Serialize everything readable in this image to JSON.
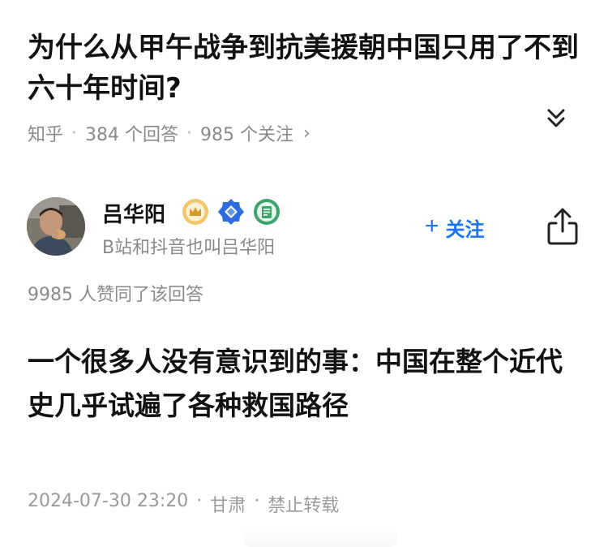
{
  "question": {
    "title": "为什么从甲午战争到抗美援朝中国只用了不到六十年时间?",
    "source": "知乎",
    "answers": "384 个回答",
    "followers": "985 个关注",
    "separator": "·",
    "chevron": "›"
  },
  "author": {
    "name": "吕华阳",
    "bio": "B站和抖音也叫吕华阳",
    "badges": [
      "crown-badge",
      "blue-diamond-badge",
      "green-book-badge"
    ],
    "follow_plus": "+",
    "follow_label": "关注"
  },
  "answer": {
    "upvote_text": "9985 人赞同了该回答",
    "content": "一个很多人没有意识到的事：中国在整个近代史几乎试遍了各种救国路径",
    "date": "2024-07-30 23:20",
    "location": "甘肃",
    "copyright": "禁止转载",
    "separator": "·"
  },
  "icons": {
    "collapse": "double-chevron-down-icon",
    "share": "share-icon",
    "avatar": "author-avatar-photo"
  },
  "colors": {
    "accent": "#1772f6",
    "muted_text": "#8a8a8a",
    "title_text": "#121212"
  }
}
